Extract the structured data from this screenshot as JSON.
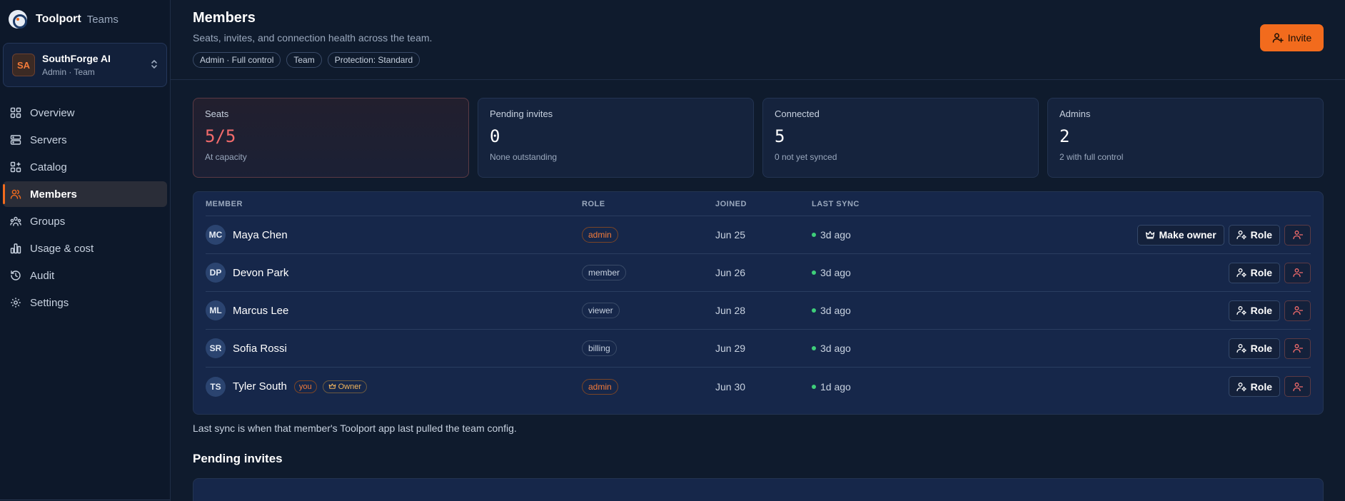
{
  "brand": {
    "name": "Toolport",
    "sub": "Teams"
  },
  "team": {
    "initials": "SA",
    "name": "SouthForge AI",
    "role": "Admin · Team"
  },
  "nav": [
    {
      "label": "Overview",
      "icon": "grid-icon",
      "active": false
    },
    {
      "label": "Servers",
      "icon": "server-icon",
      "active": false
    },
    {
      "label": "Catalog",
      "icon": "catalog-icon",
      "active": false
    },
    {
      "label": "Members",
      "icon": "users-icon",
      "active": true
    },
    {
      "label": "Groups",
      "icon": "groups-icon",
      "active": false
    },
    {
      "label": "Usage & cost",
      "icon": "bar-chart-icon",
      "active": false
    },
    {
      "label": "Audit",
      "icon": "history-icon",
      "active": false
    },
    {
      "label": "Settings",
      "icon": "gear-icon",
      "active": false
    }
  ],
  "header": {
    "title": "Members",
    "subtitle": "Seats, invites, and connection health across the team.",
    "chips": [
      "Admin · Full control",
      "Team",
      "Protection: Standard"
    ],
    "invite_label": "Invite"
  },
  "stats": [
    {
      "label": "Seats",
      "value": "5/5",
      "note": "At capacity"
    },
    {
      "label": "Pending invites",
      "value": "0",
      "note": "None outstanding"
    },
    {
      "label": "Connected",
      "value": "5",
      "note": "0 not yet synced"
    },
    {
      "label": "Admins",
      "value": "2",
      "note": "2 with full control"
    }
  ],
  "table": {
    "headers": {
      "member": "MEMBER",
      "role": "ROLE",
      "joined": "JOINED",
      "sync": "LAST SYNC"
    },
    "make_owner_label": "Make owner",
    "role_label": "Role",
    "you_label": "you",
    "owner_label": "Owner",
    "rows": [
      {
        "initials": "MC",
        "name": "Maya Chen",
        "role": "admin",
        "joined": "Jun 25",
        "sync": "3d ago"
      },
      {
        "initials": "DP",
        "name": "Devon Park",
        "role": "member",
        "joined": "Jun 26",
        "sync": "3d ago"
      },
      {
        "initials": "ML",
        "name": "Marcus Lee",
        "role": "viewer",
        "joined": "Jun 28",
        "sync": "3d ago"
      },
      {
        "initials": "SR",
        "name": "Sofia Rossi",
        "role": "billing",
        "joined": "Jun 29",
        "sync": "3d ago"
      },
      {
        "initials": "TS",
        "name": "Tyler South",
        "role": "admin",
        "joined": "Jun 30",
        "sync": "1d ago"
      }
    ]
  },
  "foot_note": "Last sync is when that member's Toolport app last pulled the team config.",
  "pending_title": "Pending invites",
  "colors": {
    "accent": "#f26b1d",
    "danger": "#f26b6b",
    "online": "#3ecf7a"
  }
}
